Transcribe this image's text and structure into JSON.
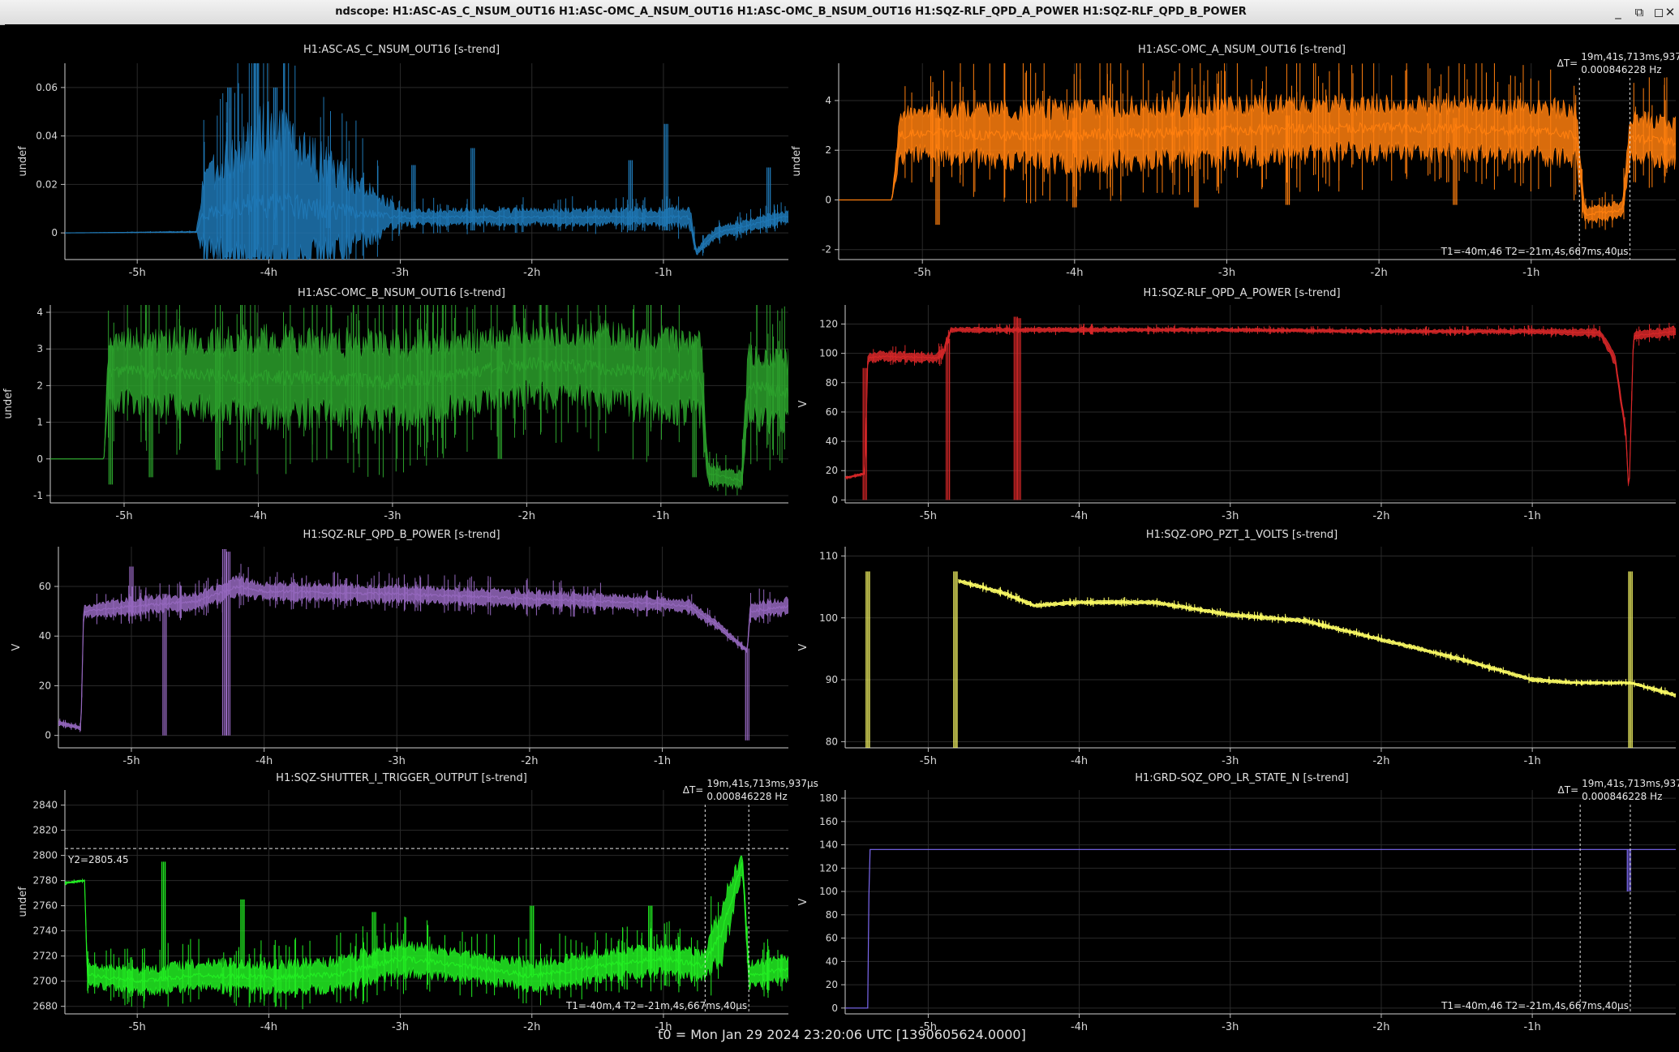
{
  "window": {
    "title": "ndscope: H1:ASC-AS_C_NSUM_OUT16 H1:ASC-OMC_A_NSUM_OUT16 H1:ASC-OMC_B_NSUM_OUT16 H1:SQZ-RLF_QPD_A_POWER H1:SQZ-RLF_QPD_B_POWER",
    "buttons": {
      "minimize": "_",
      "restore": "⧉",
      "maximize": "◻",
      "close": "✕"
    }
  },
  "footer": "t0 = Mon Jan 29 2024 23:20:06 UTC [1390605624.0000]",
  "x_axis": {
    "range_hours": [
      -5.55,
      -0.05
    ],
    "ticks": [
      -5,
      -4,
      -3,
      -2,
      -1
    ],
    "tick_labels": [
      "-5h",
      "-4h",
      "-3h",
      "-2h",
      "-1h"
    ]
  },
  "cursor_readout": {
    "delta_label": "ΔT=",
    "delta_value": "19m,41s,713ms,937μs",
    "freq": "0.000846228 Hz",
    "t_text_full": "T1=-40m,46 T2=-21m,4s,667ms,40μs",
    "t_text_short": "T1=-40m,4 T2=-21m,4s,667ms,40μs",
    "t1_hours": -0.683,
    "t2_hours": -0.351
  },
  "chart_data": [
    {
      "type": "line",
      "title": "H1:ASC-AS_C_NSUM_OUT16 [s-trend]",
      "ylabel": "undef",
      "ylim": [
        -0.011,
        0.07
      ],
      "yticks": [
        0,
        0.02,
        0.04,
        0.06
      ],
      "ytick_labels": [
        "0",
        "0.02",
        "0.04",
        "0.06"
      ],
      "color": "#1f77b4",
      "x": [
        -5.55,
        -4.55,
        -4.5,
        -4.0,
        -3.0,
        -2.0,
        -1.0,
        -0.8,
        -0.75,
        -0.6,
        -0.05
      ],
      "y": [
        0.0,
        0.0004,
        0.008,
        0.012,
        0.0065,
        0.0065,
        0.0065,
        0.0065,
        -0.008,
        0.0,
        0.007
      ],
      "spread": [
        0,
        0.0003,
        0.02,
        0.045,
        0.004,
        0.004,
        0.004,
        0.006,
        0.002,
        0.003,
        0.003
      ],
      "spikes": [
        [
          -4.3,
          -0.01,
          0.06
        ],
        [
          -4.1,
          -0.01,
          0.07
        ],
        [
          -3.95,
          -0.005,
          0.06
        ],
        [
          -3.55,
          0.002,
          0.03
        ],
        [
          -2.9,
          0.002,
          0.028
        ],
        [
          -2.45,
          0.001,
          0.035
        ],
        [
          -1.25,
          0.001,
          0.03
        ],
        [
          -0.98,
          0.001,
          0.045
        ],
        [
          -0.2,
          0.002,
          0.027
        ]
      ],
      "cursor": false
    },
    {
      "type": "line",
      "title": "H1:ASC-OMC_A_NSUM_OUT16 [s-trend]",
      "ylabel": "undef",
      "ylim": [
        -2.4,
        5.5
      ],
      "yticks": [
        -2,
        0,
        2,
        4
      ],
      "ytick_labels": [
        "-2",
        "0",
        "2",
        "4"
      ],
      "color": "#ff7f0e",
      "x": [
        -5.55,
        -5.2,
        -5.15,
        -5.0,
        -4.5,
        -4.0,
        -3.0,
        -2.0,
        -1.0,
        -0.7,
        -0.65,
        -0.4,
        -0.35,
        -0.05
      ],
      "y": [
        0.0,
        0.0,
        2.6,
        2.7,
        2.6,
        2.6,
        2.8,
        2.9,
        2.8,
        2.6,
        -0.6,
        -0.4,
        2.5,
        2.3
      ],
      "spread": [
        0,
        0,
        1.2,
        1.2,
        1.5,
        1.6,
        1.5,
        1.4,
        1.4,
        1.5,
        0.4,
        0.4,
        1.2,
        1.2
      ],
      "spikes": [
        [
          -4.9,
          -1.0,
          3.3
        ],
        [
          -4.0,
          -0.3,
          3.3
        ],
        [
          -3.2,
          -0.3,
          3.3
        ],
        [
          -2.6,
          -0.2,
          3.4
        ],
        [
          -1.5,
          -0.2,
          3.3
        ]
      ],
      "cursor": true,
      "cursor_text_below": "t_text_full"
    },
    {
      "type": "line",
      "title": "H1:ASC-OMC_B_NSUM_OUT16 [s-trend]",
      "ylabel": "undef",
      "ylim": [
        -1.2,
        4.2
      ],
      "yticks": [
        -1,
        0,
        1,
        2,
        3,
        4
      ],
      "ytick_labels": [
        "-1",
        "0",
        "1",
        "2",
        "3",
        "4"
      ],
      "color": "#2ca02c",
      "x": [
        -5.55,
        -5.15,
        -5.12,
        -5.0,
        -4.5,
        -4.0,
        -3.5,
        -3.0,
        -2.5,
        -2.0,
        -1.5,
        -1.0,
        -0.7,
        -0.65,
        -0.4,
        -0.35,
        -0.05
      ],
      "y": [
        0.0,
        0.0,
        2.3,
        2.4,
        2.3,
        2.2,
        2.2,
        2.1,
        2.3,
        2.6,
        2.5,
        2.3,
        2.2,
        -0.4,
        -0.6,
        2.0,
        1.8
      ],
      "spread": [
        0,
        0,
        1.0,
        1.2,
        1.3,
        1.5,
        1.4,
        1.5,
        1.2,
        1.2,
        1.3,
        1.4,
        1.4,
        0.3,
        0.3,
        1.3,
        1.2
      ],
      "spikes": [
        [
          -5.1,
          -0.7,
          3.1
        ],
        [
          -4.8,
          -0.5,
          3.2
        ],
        [
          -4.3,
          -0.3,
          3.0
        ],
        [
          -2.2,
          0.0,
          3.2
        ],
        [
          -0.75,
          -0.5,
          3.2
        ]
      ],
      "cursor": false
    },
    {
      "type": "line",
      "title": "H1:SQZ-RLF_QPD_A_POWER [s-trend]",
      "ylabel": "V",
      "ylim": [
        -2,
        133
      ],
      "yticks": [
        0,
        20,
        40,
        60,
        80,
        100,
        120
      ],
      "ytick_labels": [
        "0",
        "20",
        "40",
        "60",
        "80",
        "100",
        "120"
      ],
      "color": "#d62728",
      "x": [
        -5.55,
        -5.42,
        -5.4,
        -5.3,
        -4.95,
        -4.9,
        -4.85,
        -4.0,
        -3.0,
        -2.0,
        -1.0,
        -0.55,
        -0.45,
        -0.38,
        -0.36,
        -0.33,
        -0.05
      ],
      "y": [
        15,
        18,
        97,
        98,
        97,
        100,
        116,
        116,
        116,
        115,
        115,
        114,
        95,
        45,
        2,
        112,
        115
      ],
      "spread": [
        1,
        1,
        4,
        4,
        4,
        4,
        2,
        2,
        1.5,
        1.5,
        2,
        3,
        5,
        5,
        1,
        4,
        4
      ],
      "spikes": [
        [
          -5.42,
          0,
          90
        ],
        [
          -4.87,
          0,
          110
        ],
        [
          -4.42,
          0,
          125
        ],
        [
          -4.4,
          0,
          124
        ]
      ],
      "cursor": false
    },
    {
      "type": "line",
      "title": "H1:SQZ-RLF_QPD_B_POWER [s-trend]",
      "ylabel": "V",
      "ylim": [
        -5,
        76
      ],
      "yticks": [
        0,
        20,
        40,
        60
      ],
      "ytick_labels": [
        "0",
        "20",
        "40",
        "60"
      ],
      "color": "#9467bd",
      "x": [
        -5.55,
        -5.38,
        -5.36,
        -5.0,
        -4.5,
        -4.2,
        -4.0,
        -3.0,
        -2.0,
        -1.0,
        -0.8,
        -0.6,
        -0.36,
        -0.34,
        -0.05
      ],
      "y": [
        5,
        3,
        50,
        52,
        54,
        60,
        58,
        57,
        55,
        53,
        52,
        45,
        34,
        50,
        52
      ],
      "spread": [
        1,
        1,
        3,
        4,
        4,
        5,
        4,
        4,
        4,
        3,
        3,
        2,
        1,
        4,
        4
      ],
      "spikes": [
        [
          -5.0,
          48,
          68
        ],
        [
          -4.75,
          0,
          57
        ],
        [
          -4.3,
          0,
          75
        ],
        [
          -4.27,
          0,
          74
        ],
        [
          -0.36,
          -2,
          35
        ]
      ],
      "cursor": false
    },
    {
      "type": "line",
      "title": "H1:SQZ-OPO_PZT_1_VOLTS [s-trend]",
      "ylabel": "V",
      "ylim": [
        79,
        111.5
      ],
      "yticks": [
        80,
        90,
        100,
        110
      ],
      "ytick_labels": [
        "80",
        "90",
        "100",
        "110"
      ],
      "color": "#ffff66",
      "x": [
        -4.8,
        -4.5,
        -4.3,
        -4.0,
        -3.5,
        -3.0,
        -2.5,
        -2.0,
        -1.5,
        -1.0,
        -0.7,
        -0.35,
        -0.05
      ],
      "y": [
        106,
        104,
        102,
        102.5,
        102.5,
        100.5,
        99.5,
        96.5,
        93.5,
        90,
        89.5,
        89.5,
        87.5
      ],
      "spread": [
        0.4,
        0.4,
        0.4,
        0.4,
        0.4,
        0.4,
        0.4,
        0.4,
        0.4,
        0.4,
        0.3,
        0.3,
        0.4
      ],
      "spikes": [
        [
          -5.4,
          79,
          107.5
        ],
        [
          -4.82,
          79,
          107.5
        ],
        [
          -0.35,
          79,
          107.5
        ]
      ],
      "cursor": false
    },
    {
      "type": "line",
      "title": "H1:SQZ-SHUTTER_I_TRIGGER_OUTPUT [s-trend]",
      "ylabel": "undef",
      "ylim": [
        2674,
        2852
      ],
      "yticks": [
        2680,
        2700,
        2720,
        2740,
        2760,
        2780,
        2800,
        2820,
        2840
      ],
      "ytick_labels": [
        "2680",
        "2700",
        "2720",
        "2740",
        "2760",
        "2780",
        "2800",
        "2820",
        "2840"
      ],
      "color": "#22ee22",
      "x": [
        -5.55,
        -5.4,
        -5.38,
        -5.0,
        -4.5,
        -4.0,
        -3.5,
        -3.0,
        -2.5,
        -2.0,
        -1.5,
        -1.0,
        -0.7,
        -0.55,
        -0.4,
        -0.35,
        -0.05
      ],
      "y": [
        2778,
        2780,
        2705,
        2700,
        2705,
        2703,
        2705,
        2718,
        2712,
        2704,
        2712,
        2718,
        2712,
        2740,
        2795,
        2705,
        2710
      ],
      "spread": [
        1,
        1,
        10,
        12,
        14,
        14,
        16,
        16,
        14,
        14,
        14,
        14,
        14,
        30,
        10,
        12,
        12
      ],
      "spikes": [
        [
          -4.8,
          2700,
          2795
        ],
        [
          -4.2,
          2710,
          2765
        ],
        [
          -3.2,
          2710,
          2755
        ],
        [
          -2.0,
          2705,
          2760
        ],
        [
          -1.1,
          2710,
          2760
        ]
      ],
      "cursor": true,
      "cursor_text_below": "t_text_short",
      "y_cursor": 2805.45,
      "y_cursor_label": "Y2=2805.45"
    },
    {
      "type": "line",
      "title": "H1:GRD-SQZ_OPO_LR_STATE_N [s-trend]",
      "ylabel": "V",
      "ylim": [
        -5,
        187
      ],
      "yticks": [
        0,
        20,
        40,
        60,
        80,
        100,
        120,
        140,
        160,
        180
      ],
      "ytick_labels": [
        "0",
        "20",
        "40",
        "60",
        "80",
        "100",
        "120",
        "140",
        "160",
        "180"
      ],
      "color": "#7b68ee",
      "x": [
        -5.55,
        -5.4,
        -5.39,
        -4.0,
        -3.0,
        -2.0,
        -1.0,
        -0.05
      ],
      "y": [
        0,
        0,
        136,
        136,
        136,
        136,
        136,
        136
      ],
      "spread": [
        0,
        0,
        0,
        0,
        0,
        0,
        0,
        0
      ],
      "spikes": [
        [
          -0.36,
          100,
          136
        ]
      ],
      "cursor": true,
      "cursor_text_below": "t_text_full"
    }
  ]
}
